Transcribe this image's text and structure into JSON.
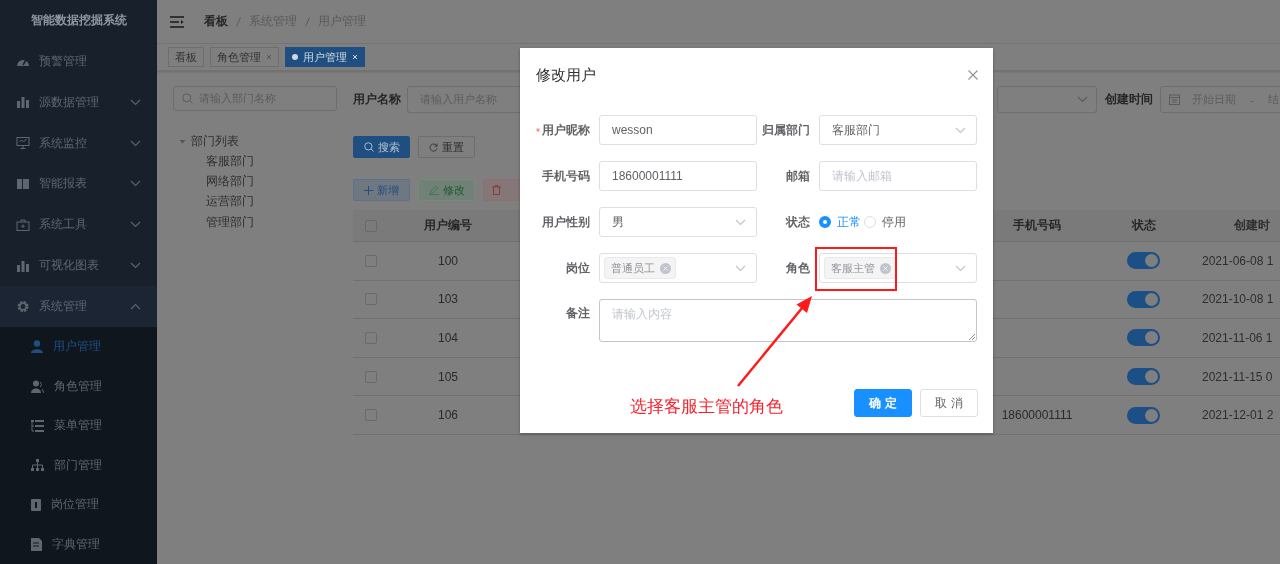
{
  "sidebar": {
    "title": "智能数据挖掘系统",
    "items": [
      {
        "label": "预警管理",
        "kind": "link",
        "expanded": false
      },
      {
        "label": "源数据管理",
        "kind": "submenu",
        "expanded": false
      },
      {
        "label": "系统监控",
        "kind": "submenu",
        "expanded": false
      },
      {
        "label": "智能报表",
        "kind": "submenu",
        "expanded": false
      },
      {
        "label": "系统工具",
        "kind": "submenu",
        "expanded": false
      },
      {
        "label": "可视化图表",
        "kind": "submenu",
        "expanded": false
      },
      {
        "label": "系统管理",
        "kind": "submenu",
        "expanded": true,
        "children": [
          {
            "label": "用户管理",
            "selected": true
          },
          {
            "label": "角色管理",
            "selected": false
          },
          {
            "label": "菜单管理",
            "selected": false
          },
          {
            "label": "部门管理",
            "selected": false
          },
          {
            "label": "岗位管理",
            "selected": false
          },
          {
            "label": "字典管理",
            "selected": false
          }
        ]
      }
    ]
  },
  "header": {
    "breadcrumbs": [
      "看板",
      "系统管理",
      "用户管理"
    ]
  },
  "tags": [
    {
      "label": "看板",
      "selected": false,
      "closable": false
    },
    {
      "label": "角色管理",
      "selected": false,
      "closable": true
    },
    {
      "label": "用户管理",
      "selected": true,
      "closable": true
    }
  ],
  "dept_panel": {
    "search": {
      "placeholder": "请输入部门名称"
    },
    "tree": [
      {
        "label": "部门列表",
        "expanded": true,
        "children": [
          {
            "label": "客服部门"
          },
          {
            "label": "网络部门"
          },
          {
            "label": "运营部门"
          },
          {
            "label": "管理部门"
          }
        ]
      }
    ]
  },
  "search_form": {
    "username": {
      "label": "用户名称",
      "placeholder": "请输入用户名称"
    },
    "created_time": {
      "label": "创建时间",
      "start_placeholder": "开始日期",
      "separator": "-",
      "end_placeholder": "结"
    }
  },
  "buttons": [
    {
      "label": "搜索",
      "kind": "search"
    },
    {
      "label": "重置",
      "kind": "reset"
    }
  ],
  "actions": [
    {
      "label": "新增",
      "kind": "add"
    },
    {
      "label": "修改",
      "kind": "edit"
    },
    {
      "kind": "delete"
    }
  ],
  "table": {
    "columns": [
      "用户编号",
      "手机号码",
      "状态",
      "创建时"
    ],
    "header_checked": false,
    "rows": [
      {
        "user_id": "100",
        "checked": false,
        "enabled": true,
        "created": "2021-06-08 1"
      },
      {
        "user_id": "103",
        "checked": false,
        "enabled": true,
        "created": "2021-10-08 1"
      },
      {
        "user_id": "104",
        "checked": false,
        "enabled": true,
        "created": "2021-11-06 1"
      },
      {
        "user_id": "105",
        "checked": false,
        "enabled": true,
        "created": "2021-11-15 0"
      },
      {
        "user_id": "106",
        "checked": false,
        "phone": "18600001111",
        "enabled": true,
        "created": "2021-12-01 2"
      }
    ]
  },
  "dialog": {
    "title": "修改用户",
    "fields": [
      {
        "label": "用户昵称",
        "kind": "input",
        "required": true,
        "value": "wesson"
      },
      {
        "label": "归属部门",
        "kind": "select",
        "required": false,
        "value": "客服部门"
      },
      {
        "label": "手机号码",
        "kind": "input",
        "required": false,
        "value": "18600001111"
      },
      {
        "label": "邮箱",
        "kind": "input",
        "required": false,
        "placeholder": "请输入邮箱"
      },
      {
        "label": "用户性别",
        "kind": "select",
        "required": false,
        "value": "男"
      },
      {
        "label": "状态",
        "kind": "radio",
        "required": false,
        "options": [
          {
            "label": "正常",
            "selected": true
          },
          {
            "label": "停用",
            "selected": false
          }
        ]
      },
      {
        "label": "岗位",
        "kind": "multiselect",
        "required": false,
        "tags": [
          "普通员工"
        ]
      },
      {
        "label": "角色",
        "kind": "multiselect",
        "required": false,
        "tags": [
          "客服主管"
        ]
      },
      {
        "label": "备注",
        "kind": "textarea",
        "required": false,
        "placeholder": "请输入内容"
      }
    ],
    "buttons": [
      {
        "label": "确 定",
        "kind": "primary"
      },
      {
        "label": "取 消",
        "kind": "default"
      }
    ],
    "annotation": {
      "text": "选择客服主管的角色"
    }
  }
}
